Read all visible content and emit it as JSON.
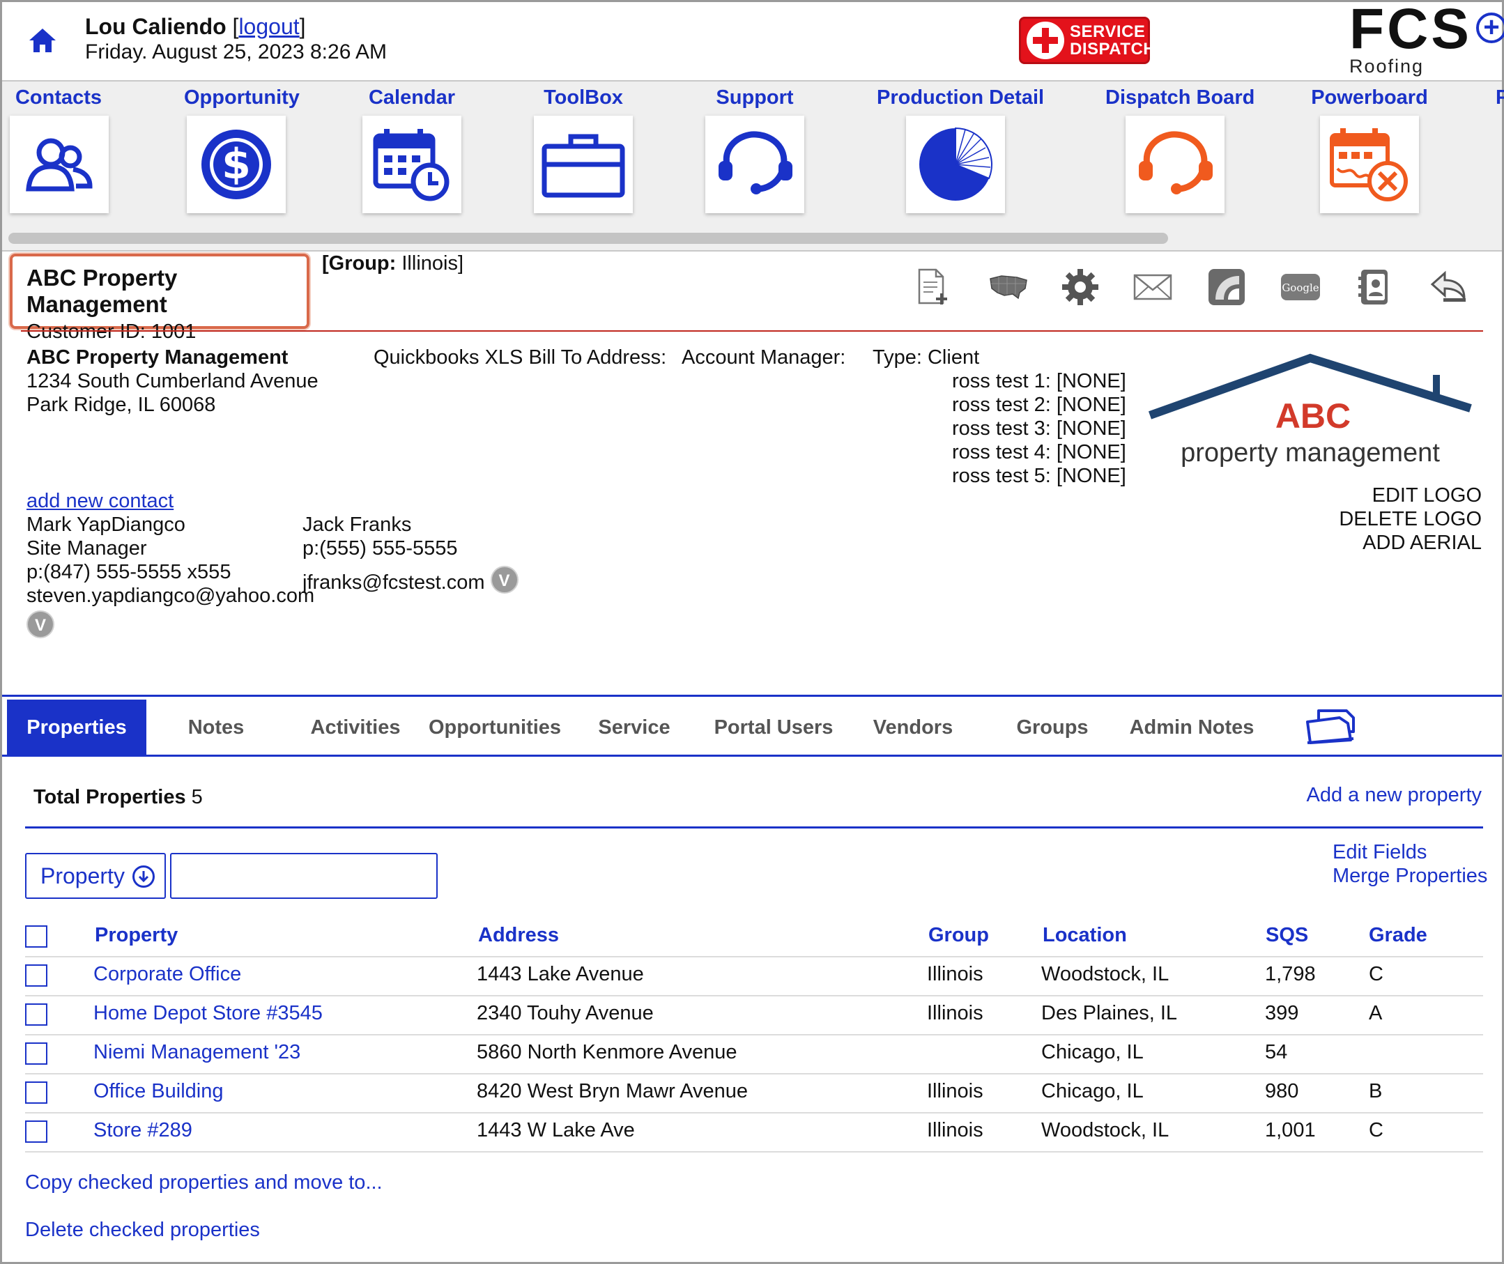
{
  "header": {
    "user_name": "Lou Caliendo",
    "logout_open": "[",
    "logout_label": "logout",
    "logout_close": "]",
    "datetime": "Friday. August 25, 2023 8:26 AM",
    "service_dispatch_line1": "SERVICE",
    "service_dispatch_line2": "DISPATCH",
    "brand_big": "FCS",
    "brand_plus": "+",
    "brand_small": "Roofing Software"
  },
  "nav": {
    "items": [
      {
        "label": "Contacts",
        "icon": "contacts-icon"
      },
      {
        "label": "Opportunity",
        "icon": "dollar-icon"
      },
      {
        "label": "Calendar",
        "icon": "calendar-icon"
      },
      {
        "label": "ToolBox",
        "icon": "briefcase-icon"
      },
      {
        "label": "Support",
        "icon": "headset-icon"
      },
      {
        "label": "Production Detail",
        "icon": "pie-chart-icon"
      },
      {
        "label": "Dispatch Board",
        "icon": "headset-icon"
      },
      {
        "label": "Powerboard",
        "icon": "calendar-tools-icon"
      },
      {
        "label": "F",
        "icon": ""
      }
    ]
  },
  "account": {
    "name": "ABC Property Management",
    "customer_id_label": "Customer ID: 1001",
    "group_label": "[Group:",
    "group_value": " Illinois]",
    "tools": [
      "new-document-icon",
      "us-map-icon",
      "gear-icon",
      "mail-icon",
      "measure-icon",
      "google-icon",
      "contact-book-icon",
      "reply-icon"
    ],
    "google_text": "Google"
  },
  "info": {
    "company": "ABC Property Management",
    "address1": "1234 South Cumberland Avenue",
    "address2": "Park Ridge,  IL 60068",
    "qb_label": "Quickbooks XLS Bill To Address:",
    "account_manager_label": "Account Manager:",
    "type_label": "Type: Client",
    "custom_fields": [
      "ross test 1: [NONE]",
      "ross test 2: [NONE]",
      "ross test 3: [NONE]",
      "ross test 4: [NONE]",
      "ross test 5: [NONE]"
    ],
    "logo_abc": "ABC",
    "logo_sub": "property management",
    "edit_logo": "EDIT LOGO",
    "delete_logo": "DELETE LOGO",
    "add_aerial": "ADD AERIAL",
    "add_contact": "add new contact",
    "contact1": {
      "name": "Mark YapDiangco",
      "title": "Site Manager",
      "phone": "p:(847) 555-5555 x555",
      "email": "steven.yapdiangco@yahoo.com",
      "badge": "V"
    },
    "contact2": {
      "name": "Jack Franks",
      "phone": "p:(555) 555-5555",
      "email": "jfranks@fcstest.com",
      "badge": "V"
    }
  },
  "tabs": [
    {
      "label": "Properties",
      "active": true
    },
    {
      "label": "Notes"
    },
    {
      "label": "Activities"
    },
    {
      "label": "Opportunities"
    },
    {
      "label": "Service"
    },
    {
      "label": "Portal Users"
    },
    {
      "label": "Vendors"
    },
    {
      "label": "Groups"
    },
    {
      "label": "Admin Notes"
    }
  ],
  "properties": {
    "total_label": "Total Properties",
    "total_value": " 5",
    "add_new": "Add a new property",
    "filter_select": "Property",
    "filter_input_value": "",
    "edit_fields": "Edit Fields",
    "merge": "Merge Properties",
    "columns": [
      "Property",
      "Address",
      "Group",
      "Location",
      "SQS",
      "Grade"
    ],
    "rows": [
      {
        "property": "Corporate Office",
        "address": "1443 Lake Avenue",
        "group": "Illinois",
        "location": "Woodstock, IL",
        "sqs": "1,798",
        "grade": "C"
      },
      {
        "property": "Home Depot Store #3545",
        "address": "2340 Touhy Avenue",
        "group": "Illinois",
        "location": "Des Plaines, IL",
        "sqs": "399",
        "grade": "A"
      },
      {
        "property": "Niemi Management '23",
        "address": "5860 North Kenmore Avenue",
        "group": "",
        "location": "Chicago, IL",
        "sqs": "54",
        "grade": ""
      },
      {
        "property": "Office Building",
        "address": "8420 West Bryn Mawr Avenue",
        "group": "Illinois",
        "location": "Chicago, IL",
        "sqs": "980",
        "grade": "B"
      },
      {
        "property": "Store #289",
        "address": "1443 W Lake Ave",
        "group": "Illinois",
        "location": "Woodstock, IL",
        "sqs": "1,001",
        "grade": "C"
      }
    ],
    "copy_action": "Copy checked properties and move to...",
    "delete_action": "Delete checked properties"
  },
  "colors": {
    "brand_blue": "#1a32c8",
    "dispatch_orange": "#f05a1e",
    "service_red": "#e3121b",
    "logo_navy": "#1f4470",
    "logo_red": "#d23a2a"
  }
}
